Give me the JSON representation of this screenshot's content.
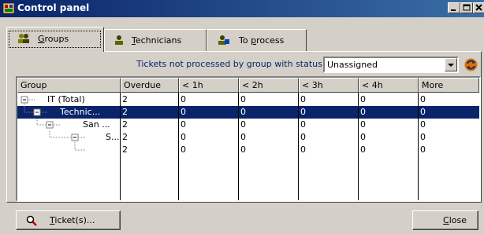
{
  "window": {
    "title": "Control panel",
    "controls": [
      "minimize-icon",
      "maximize-icon",
      "close-icon"
    ]
  },
  "tabs": [
    {
      "label_pre": "",
      "label_u": "G",
      "label_post": "roups",
      "icon": "group-icon",
      "active": true
    },
    {
      "label_pre": "",
      "label_u": "T",
      "label_post": "echnicians",
      "icon": "technician-icon",
      "active": false
    },
    {
      "label_pre": "To ",
      "label_u": "p",
      "label_post": "rocess",
      "icon": "to-process-icon",
      "active": false
    }
  ],
  "filter": {
    "label": "Tickets not processed by group with status:",
    "value": "Unassigned",
    "dropdown_icon": "chevron-down-icon",
    "refresh_icon": "refresh-icon"
  },
  "table": {
    "columns": [
      "Group",
      "Overdue",
      "< 1h",
      "< 2h",
      "< 3h",
      "< 4h",
      "More"
    ],
    "rows": [
      {
        "cells": [
          "IT (Total)",
          "2",
          "0",
          "0",
          "0",
          "0",
          "0"
        ],
        "selected": false
      },
      {
        "cells": [
          "Technic...",
          "2",
          "0",
          "0",
          "0",
          "0",
          "0"
        ],
        "selected": true
      },
      {
        "cells": [
          "San ...",
          "2",
          "0",
          "0",
          "0",
          "0",
          "0"
        ],
        "selected": false
      },
      {
        "cells": [
          "S...",
          "2",
          "0",
          "0",
          "0",
          "0",
          "0"
        ],
        "selected": false
      },
      {
        "cells": [
          "",
          "2",
          "0",
          "0",
          "0",
          "0",
          "0"
        ],
        "selected": false
      }
    ]
  },
  "buttons": {
    "tickets": {
      "label_u": "T",
      "label_post": "icket(s)...",
      "icon": "search-icon"
    },
    "close": {
      "label_u": "C",
      "label_post": "lose"
    }
  },
  "colors": {
    "titlebar": "#0a246a",
    "selection": "#0a246a",
    "face": "#d4d0c8",
    "label": "#0a246a"
  }
}
